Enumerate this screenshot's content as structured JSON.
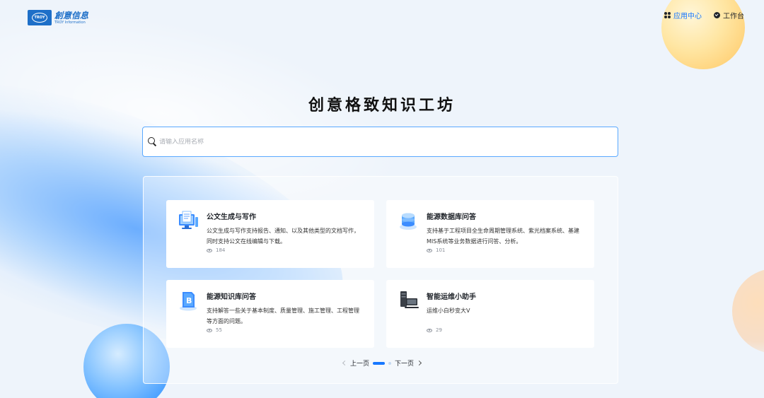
{
  "header": {
    "logo_cn": "創意信息",
    "logo_en": "TROY Information",
    "logo_badge": "TROY",
    "nav": [
      {
        "label": "应用中心",
        "icon": "apps-icon",
        "active": true
      },
      {
        "label": "工作台",
        "icon": "workbench-icon",
        "active": false
      }
    ]
  },
  "main": {
    "title": "创意格致知识工坊",
    "search_placeholder": "请输入应用名称"
  },
  "cards": [
    {
      "title": "公文生成与写作",
      "desc": "公文生成与写作支持报告、通知、以及其他类型的文档写作，同时支持公文在线编辑与下载。",
      "views": "184",
      "icon": "document-computer-icon"
    },
    {
      "title": "能源数据库问答",
      "desc": "支持基于工程项目全生命周期管理系统、紫光档案系统、基建MIS系统等业务数据进行问答、分析。",
      "views": "101",
      "icon": "database-icon"
    },
    {
      "title": "能源知识库问答",
      "desc": "支持解答一些关于基本制度、质量管理、施工管理、工程管理等方面的问题。",
      "views": "55",
      "icon": "knowledge-book-icon"
    },
    {
      "title": "智能运维小助手",
      "desc": "运维小白秒变大V",
      "views": "29",
      "icon": "server-monitor-icon"
    }
  ],
  "pager": {
    "prev": "上一页",
    "next": "下一页"
  },
  "colors": {
    "accent": "#1677ff",
    "logo": "#1e6fc8"
  }
}
